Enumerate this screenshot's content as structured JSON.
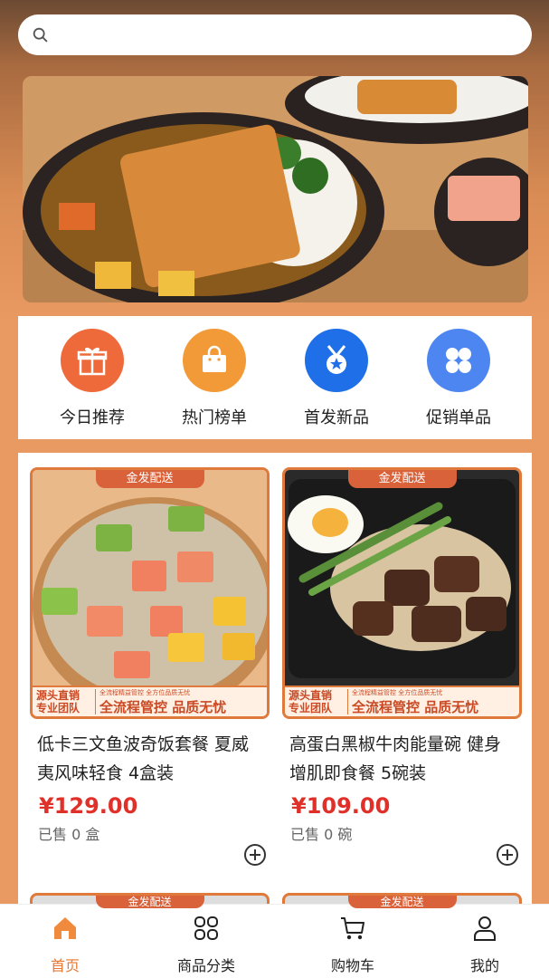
{
  "search": {
    "placeholder": ""
  },
  "quick_links": [
    {
      "label": "今日推荐",
      "icon": "gift-icon",
      "color": "#ee6a3a"
    },
    {
      "label": "热门榜单",
      "icon": "shopping-bag-icon",
      "color": "#f29a37"
    },
    {
      "label": "首发新品",
      "icon": "medal-icon",
      "color": "#1e6fe8"
    },
    {
      "label": "促销单品",
      "icon": "four-petal-icon",
      "color": "#4d86f0"
    }
  ],
  "products": [
    {
      "tag": "金发配送",
      "foot_left_1": "源头直销",
      "foot_left_2": "专业团队",
      "foot_small": "全流程精益管控 全方位品质无忧",
      "foot_main": "全流程管控 品质无忧",
      "title": "低卡三文鱼波奇饭套餐 夏威夷风味轻食 4盒装",
      "price": "¥129.00",
      "sold": "已售 0 盒"
    },
    {
      "tag": "金发配送",
      "foot_left_1": "源头直销",
      "foot_left_2": "专业团队",
      "foot_small": "全流程精益管控 全方位品质无忧",
      "foot_main": "全流程管控 品质无忧",
      "title": "高蛋白黑椒牛肉能量碗 健身增肌即食餐 5碗装",
      "price": "¥109.00",
      "sold": "已售 0 碗"
    }
  ],
  "peek_tags": [
    "金发配送",
    "金发配送"
  ],
  "tabbar": [
    {
      "label": "首页",
      "icon": "home-icon",
      "active": true
    },
    {
      "label": "商品分类",
      "icon": "category-grid-icon",
      "active": false
    },
    {
      "label": "购物车",
      "icon": "cart-icon",
      "active": false
    },
    {
      "label": "我的",
      "icon": "user-icon",
      "active": false
    }
  ],
  "colors": {
    "accent": "#e8762e",
    "price": "#e0302a",
    "page_bg": "#e99a62"
  }
}
